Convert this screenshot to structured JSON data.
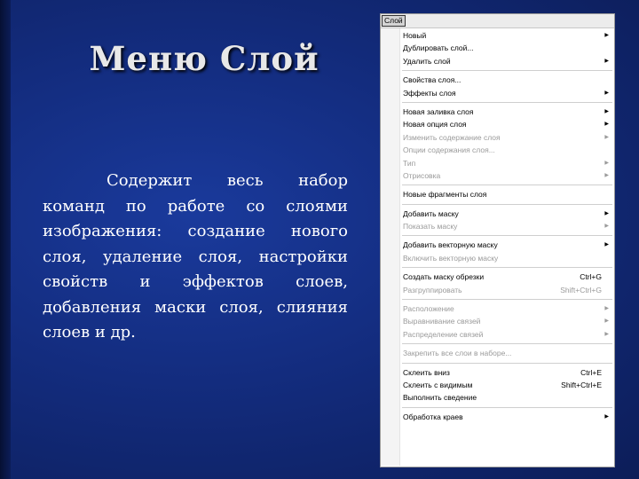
{
  "slide": {
    "title": "Меню Слой",
    "body": "Содержит весь набор команд по работе со слоями изображения: создание нового слоя, удаление слоя, настройки свойств и эффектов слоев, добавления маски слоя, слияния слоев и др."
  },
  "menu": {
    "header_label": "Слой",
    "items": [
      {
        "label": "Новый",
        "shortcut": "",
        "submenu": true,
        "disabled": false
      },
      {
        "label": "Дублировать слой...",
        "shortcut": "",
        "submenu": false,
        "disabled": false
      },
      {
        "label": "Удалить слой",
        "shortcut": "",
        "submenu": true,
        "disabled": false
      },
      {
        "separator": true
      },
      {
        "label": "Свойства слоя...",
        "shortcut": "",
        "submenu": false,
        "disabled": false
      },
      {
        "label": "Эффекты слоя",
        "shortcut": "",
        "submenu": true,
        "disabled": false
      },
      {
        "separator": true
      },
      {
        "label": "Новая заливка слоя",
        "shortcut": "",
        "submenu": true,
        "disabled": false
      },
      {
        "label": "Новая опция слоя",
        "shortcut": "",
        "submenu": true,
        "disabled": false
      },
      {
        "label": "Изменить содержание слоя",
        "shortcut": "",
        "submenu": true,
        "disabled": true
      },
      {
        "label": "Опции содержания слоя...",
        "shortcut": "",
        "submenu": false,
        "disabled": true
      },
      {
        "label": "Тип",
        "shortcut": "",
        "submenu": true,
        "disabled": true
      },
      {
        "label": "Отрисовка",
        "shortcut": "",
        "submenu": true,
        "disabled": true
      },
      {
        "separator": true
      },
      {
        "label": "Новые фрагменты слоя",
        "shortcut": "",
        "submenu": false,
        "disabled": false
      },
      {
        "separator": true
      },
      {
        "label": "Добавить маску",
        "shortcut": "",
        "submenu": true,
        "disabled": false
      },
      {
        "label": "Показать маску",
        "shortcut": "",
        "submenu": true,
        "disabled": true
      },
      {
        "separator": true
      },
      {
        "label": "Добавить векторную маску",
        "shortcut": "",
        "submenu": true,
        "disabled": false
      },
      {
        "label": "Включить векторную маску",
        "shortcut": "",
        "submenu": false,
        "disabled": true
      },
      {
        "separator": true
      },
      {
        "label": "Создать маску обрезки",
        "shortcut": "Ctrl+G",
        "submenu": false,
        "disabled": false
      },
      {
        "label": "Разгруппировать",
        "shortcut": "Shift+Ctrl+G",
        "submenu": false,
        "disabled": true
      },
      {
        "separator": true
      },
      {
        "label": "Расположение",
        "shortcut": "",
        "submenu": true,
        "disabled": true
      },
      {
        "label": "Выравнивание связей",
        "shortcut": "",
        "submenu": true,
        "disabled": true
      },
      {
        "label": "Распределение связей",
        "shortcut": "",
        "submenu": true,
        "disabled": true
      },
      {
        "separator": true
      },
      {
        "label": "Закрепить все слои в наборе...",
        "shortcut": "",
        "submenu": false,
        "disabled": true
      },
      {
        "separator": true
      },
      {
        "label": "Склеить вниз",
        "shortcut": "Ctrl+E",
        "submenu": false,
        "disabled": false
      },
      {
        "label": "Склеить с видимым",
        "shortcut": "Shift+Ctrl+E",
        "submenu": false,
        "disabled": false
      },
      {
        "label": "Выполнить сведение",
        "shortcut": "",
        "submenu": false,
        "disabled": false
      },
      {
        "separator": true
      },
      {
        "label": "Обработка краев",
        "shortcut": "",
        "submenu": true,
        "disabled": false
      }
    ]
  }
}
